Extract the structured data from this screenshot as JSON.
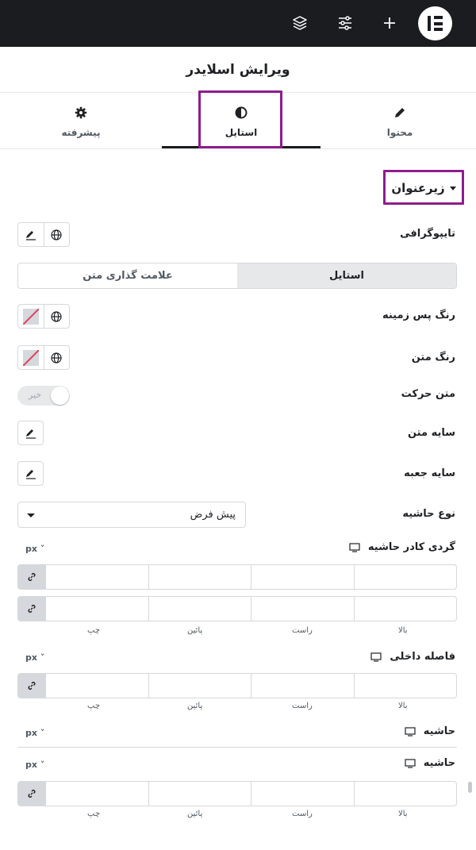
{
  "topbar": {
    "icons": [
      "elementor-logo-icon",
      "plus-icon",
      "sliders-icon",
      "layers-icon"
    ]
  },
  "panel": {
    "title": "ویرایش اسلایدر"
  },
  "tabs": [
    {
      "label": "محتوا",
      "icon": "pencil-icon"
    },
    {
      "label": "استایل",
      "icon": "contrast-icon"
    },
    {
      "label": "پیشرفته",
      "icon": "gear-icon"
    }
  ],
  "section": {
    "title": "زیرعنوان"
  },
  "controls": {
    "typography": "تایپوگرافی",
    "style_tabs": [
      "استایل",
      "علامت گذاری متن"
    ],
    "bg_color": "رنگ پس زمینه",
    "text_color": "رنگ متن",
    "text_motion": "متن حرکت",
    "toggle_off_label": "خیر",
    "text_shadow": "سایه متن",
    "box_shadow": "سایه جعبه",
    "border_type": "نوع حاشیه",
    "border_type_value": "پیش فرض",
    "border_radius": "گردی کادر حاشیه",
    "padding": "فاصله داخلی",
    "margin": "حاشیه",
    "margin_2": "حاشیه",
    "unit": "px",
    "dims": {
      "top": "بالا",
      "right": "راست",
      "bottom": "پائین",
      "left": "چپ"
    }
  },
  "colors": {
    "accent_highlight": "#8c1d8c",
    "topbar_bg": "#1b1c1f"
  }
}
